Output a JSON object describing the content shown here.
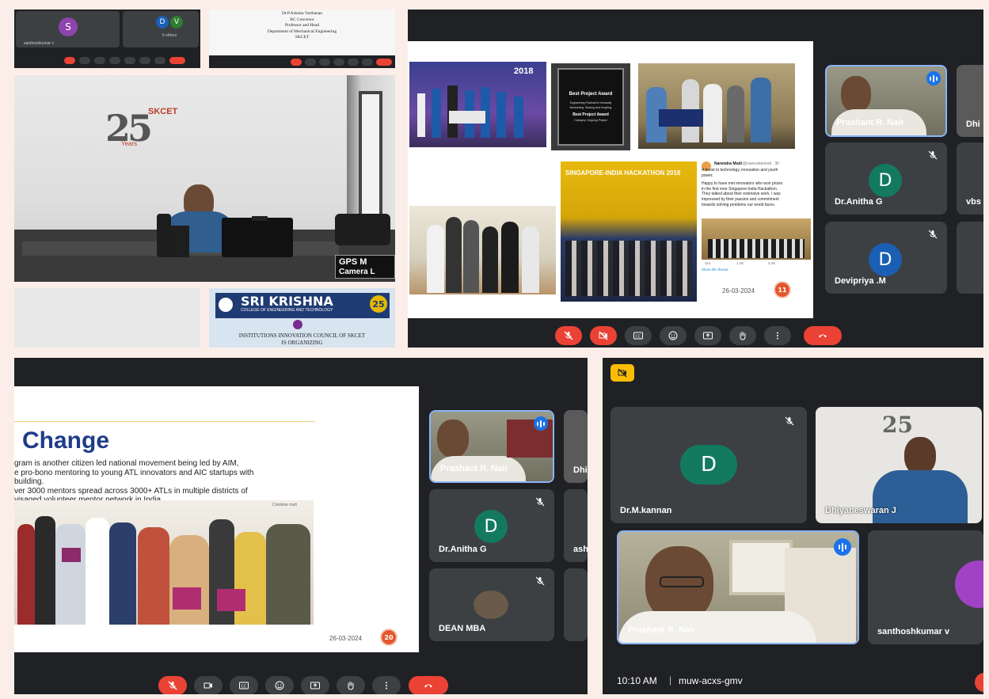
{
  "colors": {
    "meet_bg": "#202124",
    "tile_bg": "#3c4043",
    "end_call": "#ea4335",
    "speaking": "#1a73e8",
    "avatar_green": "#137a5f",
    "avatar_blue": "#1a5fb4"
  },
  "top_left": {
    "thumb_a": {
      "avatar_initial": "S",
      "name": "santhoshkumar v",
      "avatars": [
        "D",
        "V"
      ],
      "others": "6 others"
    },
    "thumb_b": {
      "lines": [
        "Dr.P.Ashoka Varthanan",
        "BC Convenor",
        "Professor and Head",
        "Department of Mechanical Engineering",
        "SKCET"
      ]
    },
    "room": {
      "logo_number": "25",
      "logo_brand": "SKCET",
      "logo_sub": "Years",
      "overlay_line1": "GPS M",
      "overlay_line2": "Camera L"
    },
    "banner": {
      "college_name": "SRI KRISHNA",
      "college_sub": "COLLEGE OF ENGINEERING AND TECHNOLOGY",
      "badge": "25",
      "council_line1": "INSTITUTIONS INNOVATION COUNCIL OF SKCET",
      "council_line2": "IS ORGANIZING"
    }
  },
  "top_right": {
    "slide": {
      "poster_year": "2018",
      "award": {
        "title": "Best Project Award",
        "body": [
          "Engineering Festival for Humanity",
          "Networking, Sharing And Inspiring",
          "Best Project Award",
          "Category: Ongoing Project"
        ]
      },
      "poster2_title": "SINGAPORE-INDIA HACKATHON 2018",
      "tweet": {
        "author": "Narendra Modi",
        "handle": "@narendramodi · 3h",
        "text": [
          "A boost to technology, innovation and youth",
          "power.",
          "",
          "Happy to have met innovators who won prizes",
          "in the first ever Singapore-India Hackathon.",
          "They talked about their extensive work. I was",
          "impressed by their passion and commitment",
          "towards solving problems our world faces."
        ],
        "stats": [
          "114",
          "1.1K",
          "3.1K"
        ],
        "show_thread": "Show this thread"
      },
      "date": "26-03-2024",
      "page": "11"
    },
    "participants": [
      {
        "name": "Prashant R. Nair",
        "speaking": true
      },
      {
        "name": "Dhi"
      },
      {
        "name": "Dr.Anitha G",
        "initial": "D"
      },
      {
        "name": "vbs"
      },
      {
        "name": "Devipriya .M",
        "initial": "D"
      }
    ]
  },
  "bottom_left": {
    "slide": {
      "heading": "Change",
      "lines": [
        "gram is another citizen led national movement being led by AIM,",
        "e pro-bono mentoring to young ATL innovators and AIC startups with",
        "building.",
        "ver 3000 mentors spread across 3000+ ATLs in multiple districts of",
        "visaged volunteer mentor network in India."
      ],
      "photo_label": "Combine mult",
      "date": "26-03-2024",
      "page": "20"
    },
    "participants": [
      {
        "name": "Prashant R. Nair",
        "speaking": true
      },
      {
        "name": "Dhi"
      },
      {
        "name": "Dr.Anitha G",
        "initial": "D"
      },
      {
        "name": "ash"
      },
      {
        "name": "DEAN MBA"
      }
    ]
  },
  "bottom_right": {
    "participants": [
      {
        "name": "Dr.M.kannan",
        "initial": "D"
      },
      {
        "name": "Dhiyaneswaran J"
      },
      {
        "name": "Prashant R. Nair",
        "speaking": true
      },
      {
        "name": "santhoshkumar v"
      }
    ],
    "footer": {
      "time": "10:10 AM",
      "separator": "|",
      "meeting_code": "muw-acxs-gmv"
    }
  }
}
